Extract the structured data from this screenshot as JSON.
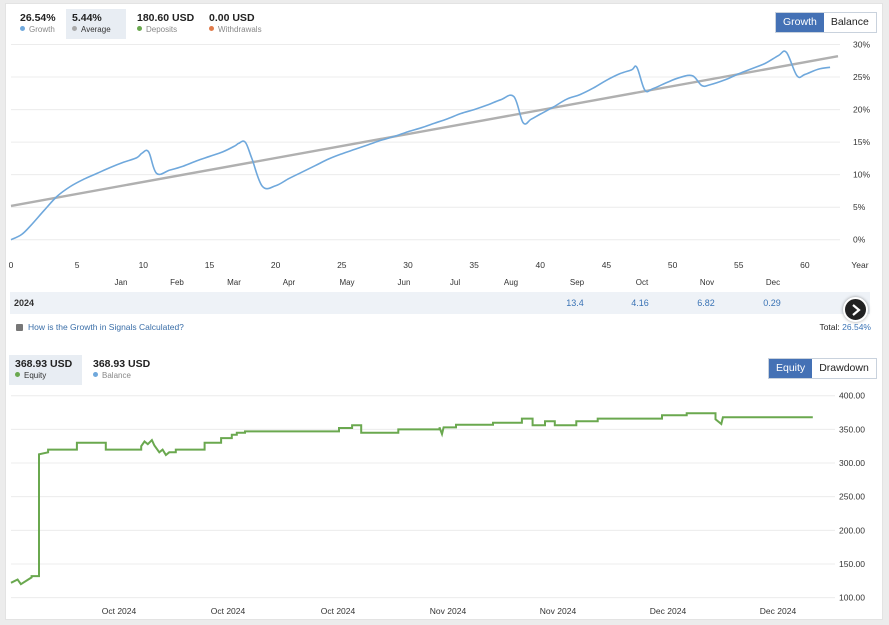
{
  "growth_panel": {
    "stats": [
      {
        "value": "26.54%",
        "label": "Growth",
        "color": "#6fa8dc"
      },
      {
        "value": "5.44%",
        "label": "Average",
        "color": "#a9a9a9"
      },
      {
        "value": "180.60 USD",
        "label": "Deposits",
        "color": "#6aa84f"
      },
      {
        "value": "0.00 USD",
        "label": "Withdrawals",
        "color": "#e07b4a"
      }
    ],
    "toggle": {
      "growth": "Growth",
      "balance": "Balance",
      "active": "growth"
    },
    "year_label": "Year",
    "year_row": {
      "year": "2024",
      "months": [
        "13.4",
        "4.16",
        "6.82",
        "0.29"
      ]
    },
    "help_link": "How is the Growth in Signals Calculated?",
    "total_label": "Total:",
    "total_value": "26.54%",
    "next_icon": "chevron-right-icon"
  },
  "equity_panel": {
    "stats": [
      {
        "value": "368.93 USD",
        "label": "Equity",
        "color": "#6aa84f"
      },
      {
        "value": "368.93 USD",
        "label": "Balance",
        "color": "#6fa8dc"
      }
    ],
    "toggle": {
      "equity": "Equity",
      "drawdown": "Drawdown",
      "active": "equity"
    }
  },
  "colors": {
    "accent": "#4471b5",
    "growth_line": "#6fa8dc",
    "trend_line": "#b0b0b0",
    "equity_line": "#6aa84f",
    "grid": "#ececec"
  },
  "chart_data": [
    {
      "type": "line",
      "title": "",
      "x_ticks": [
        0,
        5,
        10,
        15,
        20,
        25,
        30,
        35,
        40,
        45,
        50,
        55,
        60
      ],
      "month_labels": [
        "Jan",
        "Feb",
        "Mar",
        "Apr",
        "May",
        "Jun",
        "Jul",
        "Aug",
        "Sep",
        "Oct",
        "Nov",
        "Dec"
      ],
      "y_ticks": [
        "0%",
        "5%",
        "10%",
        "15%",
        "20%",
        "25%",
        "30%"
      ],
      "xlim": [
        0,
        62.5
      ],
      "ylim": [
        -2.5,
        31
      ],
      "grid": true,
      "series": [
        {
          "name": "Growth",
          "x": [
            0,
            0.8,
            1.5,
            2.5,
            3.5,
            4.5,
            5.5,
            6.5,
            7.5,
            8.5,
            9.5,
            9.9,
            10.4,
            11,
            12,
            13,
            14,
            15,
            16,
            16.9,
            17.2,
            17.7,
            18.2,
            19,
            20,
            21,
            22,
            23,
            24,
            25,
            26,
            27,
            28,
            29,
            30,
            31,
            32,
            33,
            34,
            35,
            36,
            37,
            38,
            38.7,
            39.3,
            40,
            41,
            42,
            43,
            44,
            45,
            46,
            46.9,
            47.3,
            47.9,
            48.5,
            49.5,
            50.5,
            51.5,
            52.2,
            52.8,
            54,
            55,
            56,
            57,
            58,
            58.6,
            59.4,
            60,
            61,
            61.9
          ],
          "y": [
            0,
            0.8,
            2.2,
            4.5,
            6.7,
            8.2,
            9.3,
            10.2,
            11.1,
            11.9,
            12.6,
            13.3,
            13.5,
            10.2,
            10.7,
            11.3,
            12.1,
            12.8,
            13.5,
            14.4,
            14.8,
            15,
            12.5,
            8.2,
            8.3,
            9.4,
            10.4,
            11.4,
            12.4,
            13.2,
            13.9,
            14.6,
            15.3,
            15.9,
            16.6,
            17.2,
            17.9,
            18.6,
            19.4,
            20,
            20.7,
            21.5,
            22,
            18,
            18.5,
            19.3,
            20.4,
            21.6,
            22.3,
            23.3,
            24.5,
            25.5,
            26.1,
            26.5,
            23,
            23.2,
            24.1,
            24.9,
            25.2,
            23.7,
            23.8,
            24.6,
            25.5,
            26.3,
            27.1,
            28.3,
            28.8,
            25.2,
            25.4,
            26.2,
            26.5
          ]
        },
        {
          "name": "Average",
          "x": [
            0,
            62.5
          ],
          "y": [
            5.2,
            28.2
          ]
        }
      ]
    },
    {
      "type": "line",
      "title": "",
      "x_ticks": [
        "Oct 2024",
        "Oct 2024",
        "Oct 2024",
        "Nov 2024",
        "Nov 2024",
        "Dec 2024",
        "Dec 2024"
      ],
      "y_ticks": [
        "100.00",
        "150.00",
        "200.00",
        "250.00",
        "300.00",
        "350.00",
        "400.00"
      ],
      "xlim": [
        0,
        100
      ],
      "ylim": [
        95,
        410
      ],
      "grid": true,
      "series": [
        {
          "name": "Equity",
          "x": [
            0,
            0.8,
            1.2,
            2.5,
            2.5,
            3.4,
            3.4,
            4.5,
            4.5,
            8,
            8,
            11.5,
            11.5,
            15.8,
            15.8,
            16.2,
            16.6,
            17.1,
            17.4,
            18,
            18.4,
            18.8,
            19.2,
            20,
            20,
            23.5,
            23.5,
            25.5,
            25.5,
            26.8,
            26.8,
            27.4,
            27.4,
            28.4,
            28.4,
            33.5,
            33.5,
            39.8,
            39.8,
            41.4,
            41.4,
            42.5,
            42.5,
            47,
            47,
            52,
            52,
            52.3,
            52.5,
            54,
            54,
            58.5,
            58.5,
            62,
            62,
            63.3,
            63.3,
            64.8,
            64.8,
            66,
            66,
            68.6,
            68.6,
            71.2,
            71.2,
            79,
            79,
            82,
            82,
            85.5,
            85.5,
            86.2,
            86.4,
            87.5,
            87.5,
            97.3
          ],
          "y": [
            122,
            127,
            120,
            130,
            132,
            132,
            313,
            316,
            320,
            320,
            330,
            330,
            320,
            320,
            325,
            332,
            328,
            334,
            326,
            316,
            320,
            312,
            316,
            316,
            320,
            320,
            330,
            330,
            337,
            337,
            342,
            342,
            345,
            345,
            347,
            347,
            347,
            347,
            352,
            352,
            356,
            356,
            345,
            345,
            350,
            350,
            353,
            343,
            353,
            353,
            357,
            357,
            360,
            360,
            366,
            366,
            356,
            356,
            362,
            362,
            356,
            356,
            362,
            362,
            366,
            366,
            371,
            371,
            374,
            374,
            365,
            358,
            368,
            368,
            368,
            368
          ]
        }
      ]
    }
  ]
}
